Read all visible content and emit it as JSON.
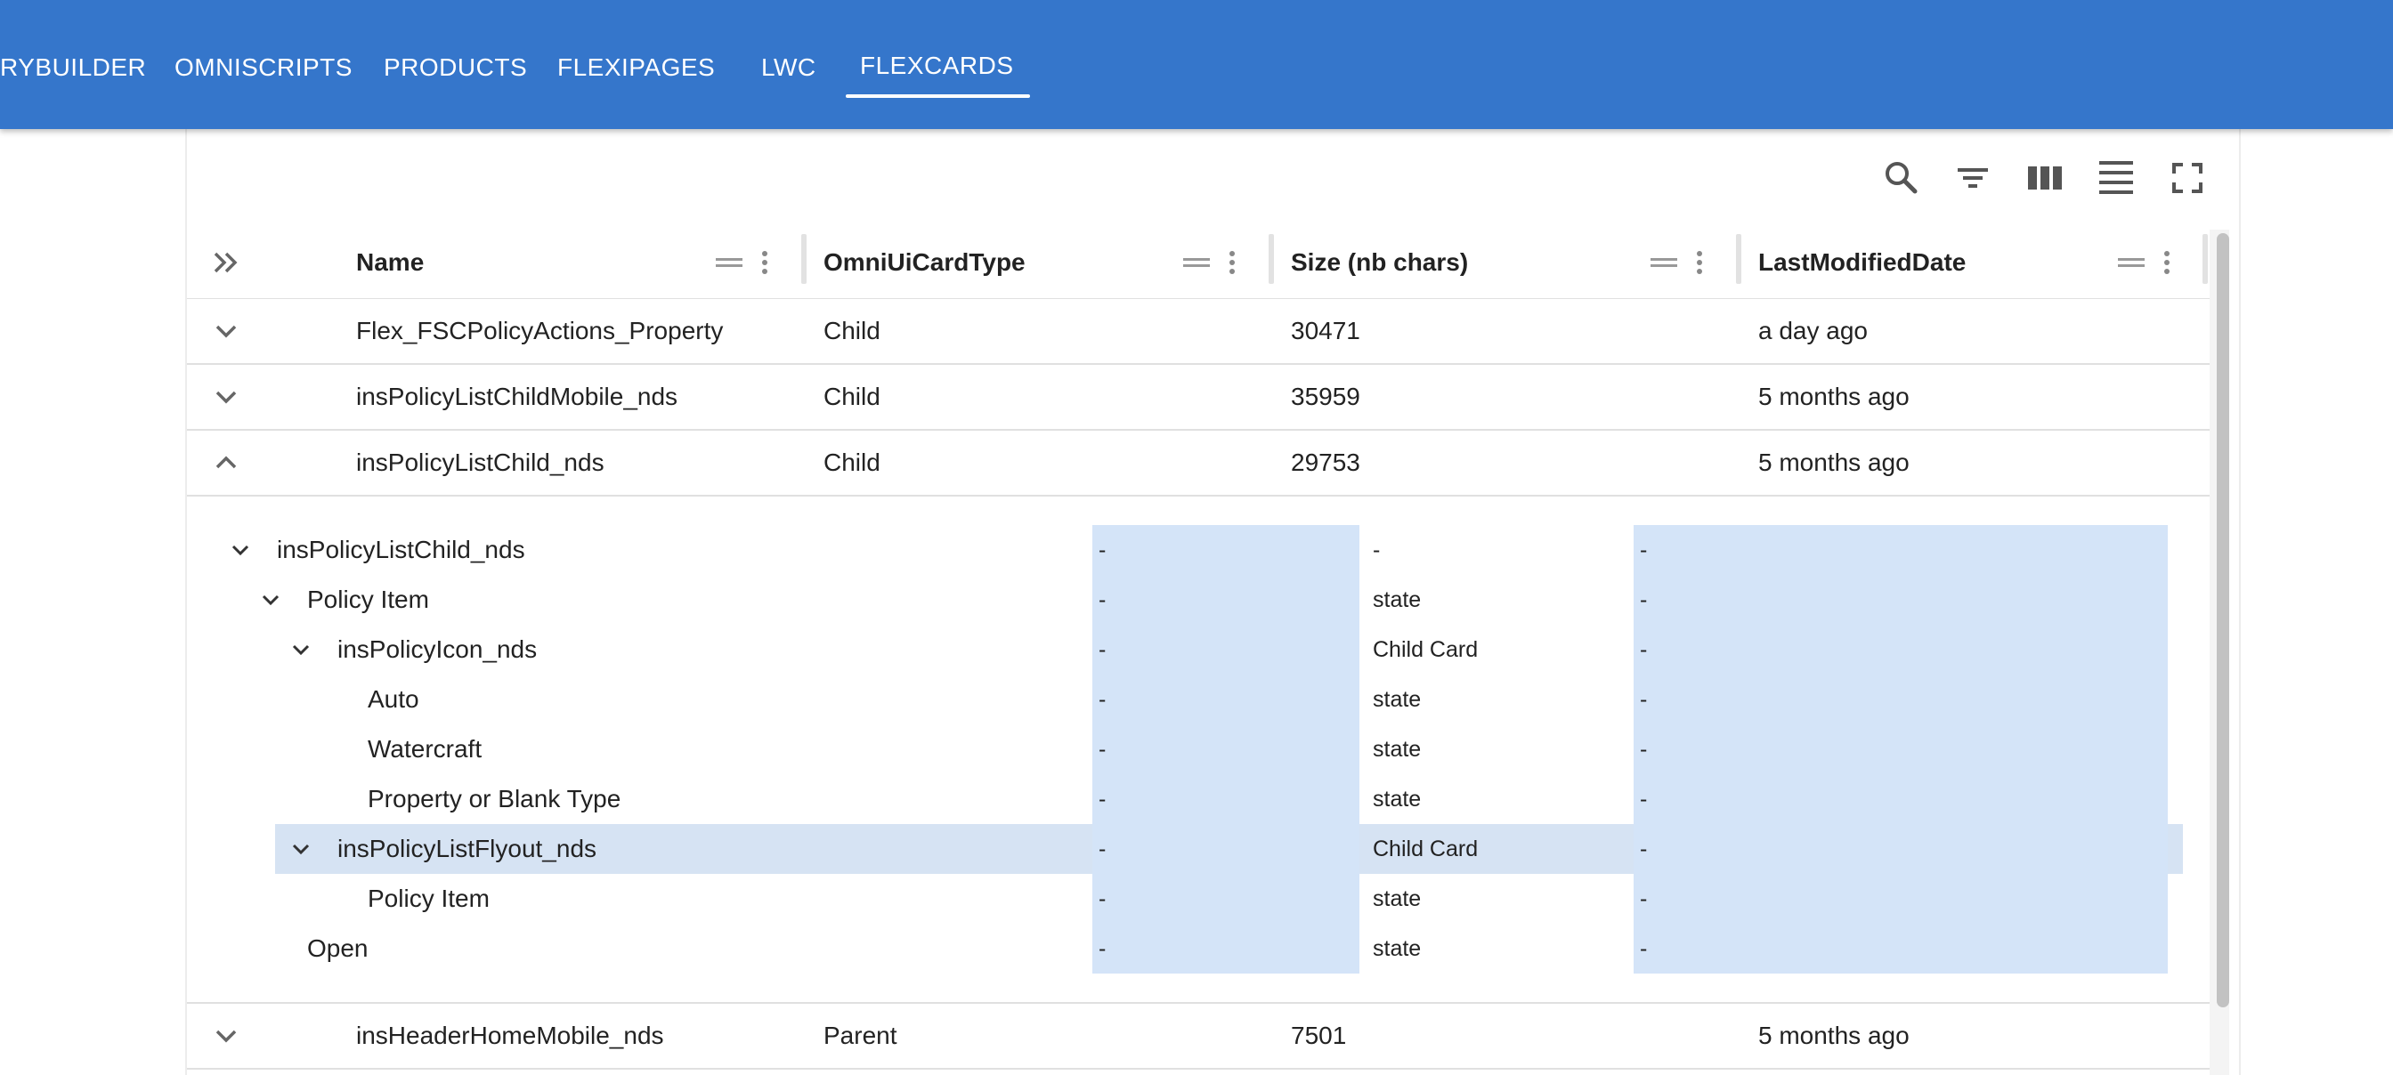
{
  "nav": {
    "tabs": [
      {
        "label": "RYBUILDER"
      },
      {
        "label": "OMNISCRIPTS"
      },
      {
        "label": "PRODUCTS"
      },
      {
        "label": "FLEXIPAGES"
      },
      {
        "label": "LWC"
      },
      {
        "label": "FLEXCARDS"
      }
    ],
    "active_tab": "FLEXCARDS"
  },
  "toolbar": {
    "icons": [
      "search-icon",
      "filter-icon",
      "columns-icon",
      "density-icon",
      "fullscreen-icon"
    ]
  },
  "grid": {
    "columns": [
      "Name",
      "OmniUiCardType",
      "Size (nb chars)",
      "LastModifiedDate"
    ],
    "rows": [
      {
        "name": "Flex_FSCPolicyActions_Property",
        "type": "Child",
        "size": "30471",
        "modified": "a day ago",
        "expanded": false
      },
      {
        "name": "insPolicyListChildMobile_nds",
        "type": "Child",
        "size": "35959",
        "modified": "5 months ago",
        "expanded": false
      },
      {
        "name": "insPolicyListChild_nds",
        "type": "Child",
        "size": "29753",
        "modified": "5 months ago",
        "expanded": true
      },
      {
        "name": "insHeaderHomeMobile_nds",
        "type": "Parent",
        "size": "7501",
        "modified": "5 months ago",
        "expanded": false
      }
    ]
  },
  "tree": {
    "rows": [
      {
        "label": "insPolicyListChild_nds",
        "c1": "-",
        "c2": "-",
        "c3": "-"
      },
      {
        "label": "Policy Item",
        "c1": "-",
        "c2": "state",
        "c3": "-"
      },
      {
        "label": "insPolicyIcon_nds",
        "c1": "-",
        "c2": "Child Card",
        "c3": "-"
      },
      {
        "label": "Auto",
        "c1": "-",
        "c2": "state",
        "c3": "-"
      },
      {
        "label": "Watercraft",
        "c1": "-",
        "c2": "state",
        "c3": "-"
      },
      {
        "label": "Property or Blank Type",
        "c1": "-",
        "c2": "state",
        "c3": "-"
      },
      {
        "label": "insPolicyListFlyout_nds",
        "c1": "-",
        "c2": "Child Card",
        "c3": "-"
      },
      {
        "label": "Policy Item",
        "c1": "-",
        "c2": "state",
        "c3": "-"
      },
      {
        "label": "Open",
        "c1": "-",
        "c2": "state",
        "c3": "-"
      }
    ],
    "selected_row": "insPolicyListFlyout_nds"
  },
  "colors": {
    "nav_bg": "#3576cb",
    "highlight": "#d4e4f8",
    "selected_row": "#d6e3f3"
  }
}
